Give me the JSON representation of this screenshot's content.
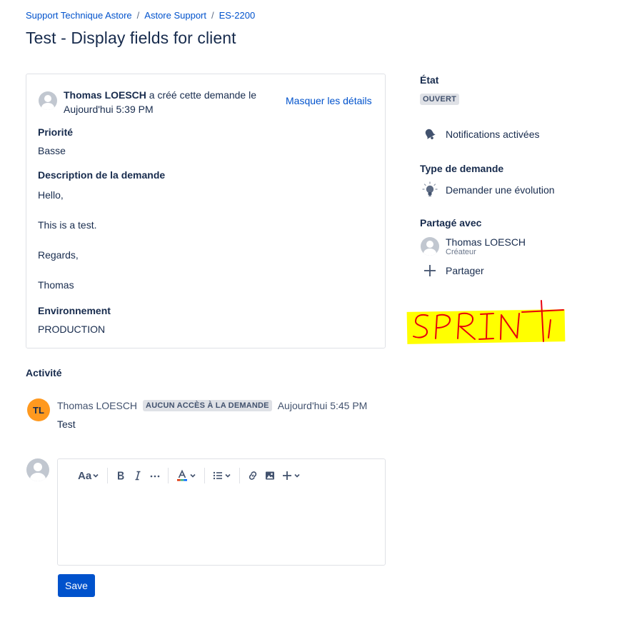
{
  "breadcrumb": [
    "Support Technique Astore",
    "Astore Support",
    "ES-2200"
  ],
  "page": {
    "title": "Test - Display fields for client"
  },
  "request": {
    "author": "Thomas LOESCH",
    "action": "a créé cette demande le",
    "timestamp": "Aujourd'hui 5:39 PM",
    "toggle_label": "Masquer les détails",
    "fields": {
      "priority_label": "Priorité",
      "priority_value": "Basse",
      "description_label": "Description de la demande",
      "description_lines": [
        "Hello,",
        "This is a test.",
        "Regards,",
        "Thomas"
      ],
      "environment_label": "Environnement",
      "environment_value": "PRODUCTION"
    }
  },
  "sidebar": {
    "status_label": "État",
    "status_value": "OUVERT",
    "notifications_label": "Notifications activées",
    "request_type_label": "Type de demande",
    "request_type_value": "Demander une évolution",
    "shared_label": "Partagé avec",
    "shared_user_name": "Thomas LOESCH",
    "shared_user_role": "Créateur",
    "share_label": "Partager"
  },
  "annotation": {
    "text": "SPRINT",
    "highlight_color": "#ffff00",
    "ink_color": "#e8000b"
  },
  "activity": {
    "title": "Activité",
    "comment": {
      "initials": "TL",
      "author": "Thomas LOESCH",
      "access_badge": "AUCUN ACCÈS À LA DEMANDE",
      "timestamp": "Aujourd'hui 5:45 PM",
      "body": "Test"
    }
  },
  "editor": {
    "text_style_label": "Aa"
  },
  "actions": {
    "save_label": "Save"
  },
  "colors": {
    "link": "#0052cc",
    "primary_button": "#0052cc",
    "avatar_orange": "#ff991f",
    "lozenge_bg": "#dfe1e6"
  },
  "icons": [
    "bell-icon",
    "lightbulb-icon",
    "plus-icon",
    "chevron-down-icon",
    "bold-icon",
    "italic-icon",
    "more-icon",
    "text-color-icon",
    "bullet-list-icon",
    "link-icon",
    "image-icon"
  ]
}
